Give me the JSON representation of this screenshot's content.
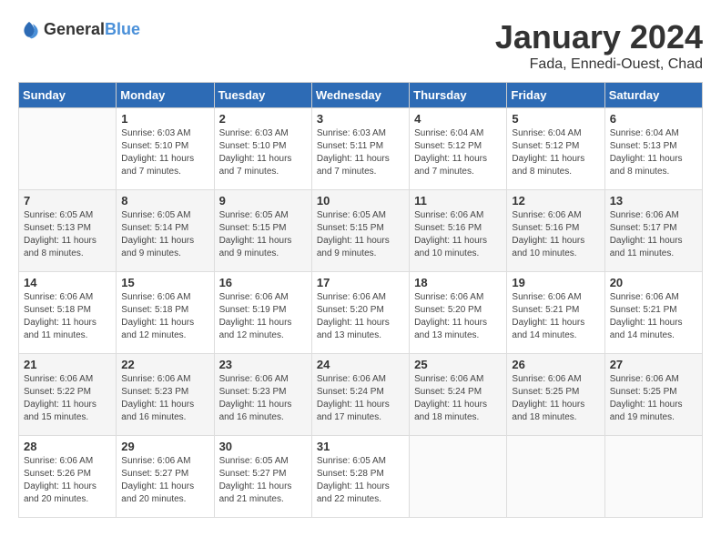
{
  "logo": {
    "general": "General",
    "blue": "Blue"
  },
  "title": "January 2024",
  "location": "Fada, Ennedi-Ouest, Chad",
  "days_header": [
    "Sunday",
    "Monday",
    "Tuesday",
    "Wednesday",
    "Thursday",
    "Friday",
    "Saturday"
  ],
  "weeks": [
    [
      {
        "day": "",
        "info": ""
      },
      {
        "day": "1",
        "info": "Sunrise: 6:03 AM\nSunset: 5:10 PM\nDaylight: 11 hours and 7 minutes."
      },
      {
        "day": "2",
        "info": "Sunrise: 6:03 AM\nSunset: 5:10 PM\nDaylight: 11 hours and 7 minutes."
      },
      {
        "day": "3",
        "info": "Sunrise: 6:03 AM\nSunset: 5:11 PM\nDaylight: 11 hours and 7 minutes."
      },
      {
        "day": "4",
        "info": "Sunrise: 6:04 AM\nSunset: 5:12 PM\nDaylight: 11 hours and 7 minutes."
      },
      {
        "day": "5",
        "info": "Sunrise: 6:04 AM\nSunset: 5:12 PM\nDaylight: 11 hours and 8 minutes."
      },
      {
        "day": "6",
        "info": "Sunrise: 6:04 AM\nSunset: 5:13 PM\nDaylight: 11 hours and 8 minutes."
      }
    ],
    [
      {
        "day": "7",
        "info": "Sunrise: 6:05 AM\nSunset: 5:13 PM\nDaylight: 11 hours and 8 minutes."
      },
      {
        "day": "8",
        "info": "Sunrise: 6:05 AM\nSunset: 5:14 PM\nDaylight: 11 hours and 9 minutes."
      },
      {
        "day": "9",
        "info": "Sunrise: 6:05 AM\nSunset: 5:15 PM\nDaylight: 11 hours and 9 minutes."
      },
      {
        "day": "10",
        "info": "Sunrise: 6:05 AM\nSunset: 5:15 PM\nDaylight: 11 hours and 9 minutes."
      },
      {
        "day": "11",
        "info": "Sunrise: 6:06 AM\nSunset: 5:16 PM\nDaylight: 11 hours and 10 minutes."
      },
      {
        "day": "12",
        "info": "Sunrise: 6:06 AM\nSunset: 5:16 PM\nDaylight: 11 hours and 10 minutes."
      },
      {
        "day": "13",
        "info": "Sunrise: 6:06 AM\nSunset: 5:17 PM\nDaylight: 11 hours and 11 minutes."
      }
    ],
    [
      {
        "day": "14",
        "info": "Sunrise: 6:06 AM\nSunset: 5:18 PM\nDaylight: 11 hours and 11 minutes."
      },
      {
        "day": "15",
        "info": "Sunrise: 6:06 AM\nSunset: 5:18 PM\nDaylight: 11 hours and 12 minutes."
      },
      {
        "day": "16",
        "info": "Sunrise: 6:06 AM\nSunset: 5:19 PM\nDaylight: 11 hours and 12 minutes."
      },
      {
        "day": "17",
        "info": "Sunrise: 6:06 AM\nSunset: 5:20 PM\nDaylight: 11 hours and 13 minutes."
      },
      {
        "day": "18",
        "info": "Sunrise: 6:06 AM\nSunset: 5:20 PM\nDaylight: 11 hours and 13 minutes."
      },
      {
        "day": "19",
        "info": "Sunrise: 6:06 AM\nSunset: 5:21 PM\nDaylight: 11 hours and 14 minutes."
      },
      {
        "day": "20",
        "info": "Sunrise: 6:06 AM\nSunset: 5:21 PM\nDaylight: 11 hours and 14 minutes."
      }
    ],
    [
      {
        "day": "21",
        "info": "Sunrise: 6:06 AM\nSunset: 5:22 PM\nDaylight: 11 hours and 15 minutes."
      },
      {
        "day": "22",
        "info": "Sunrise: 6:06 AM\nSunset: 5:23 PM\nDaylight: 11 hours and 16 minutes."
      },
      {
        "day": "23",
        "info": "Sunrise: 6:06 AM\nSunset: 5:23 PM\nDaylight: 11 hours and 16 minutes."
      },
      {
        "day": "24",
        "info": "Sunrise: 6:06 AM\nSunset: 5:24 PM\nDaylight: 11 hours and 17 minutes."
      },
      {
        "day": "25",
        "info": "Sunrise: 6:06 AM\nSunset: 5:24 PM\nDaylight: 11 hours and 18 minutes."
      },
      {
        "day": "26",
        "info": "Sunrise: 6:06 AM\nSunset: 5:25 PM\nDaylight: 11 hours and 18 minutes."
      },
      {
        "day": "27",
        "info": "Sunrise: 6:06 AM\nSunset: 5:25 PM\nDaylight: 11 hours and 19 minutes."
      }
    ],
    [
      {
        "day": "28",
        "info": "Sunrise: 6:06 AM\nSunset: 5:26 PM\nDaylight: 11 hours and 20 minutes."
      },
      {
        "day": "29",
        "info": "Sunrise: 6:06 AM\nSunset: 5:27 PM\nDaylight: 11 hours and 20 minutes."
      },
      {
        "day": "30",
        "info": "Sunrise: 6:05 AM\nSunset: 5:27 PM\nDaylight: 11 hours and 21 minutes."
      },
      {
        "day": "31",
        "info": "Sunrise: 6:05 AM\nSunset: 5:28 PM\nDaylight: 11 hours and 22 minutes."
      },
      {
        "day": "",
        "info": ""
      },
      {
        "day": "",
        "info": ""
      },
      {
        "day": "",
        "info": ""
      }
    ]
  ]
}
